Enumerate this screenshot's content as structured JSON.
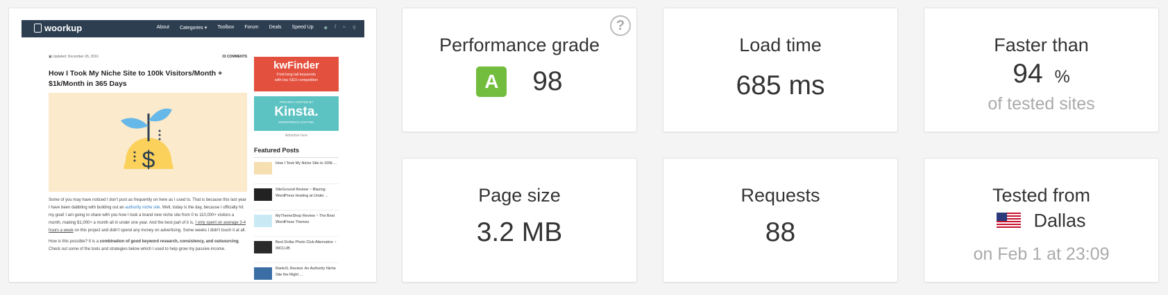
{
  "preview": {
    "site_logo": "woorkup",
    "nav_items": [
      "About",
      "Categories ▾",
      "Toolbox",
      "Forum",
      "Deals",
      "Speed Up"
    ],
    "social_icons": [
      "twitter-icon",
      "facebook-icon",
      "rss-icon",
      "search-icon"
    ],
    "date": "Updated: December 26, 2016",
    "comments": "33 COMMENTS",
    "article_title": "How I Took My Niche Site to 100k Visitors/Month + $1k/Month in 365 Days",
    "para1_a": "Some of you may have noticed I don't post as frequently on here as I used to. That is because this last year I have been dabbling with building out an ",
    "para1_link": "authority niche site",
    "para1_b": ". Well, today is the day, because I officially hit my goal! I am going to share with you how I took a brand new niche site from 0 to 110,000+ visitors a month, making $1,000+ a month all in under one year. And the best part of it is, ",
    "para1_u": "I only spent on average 3-4 hours a week",
    "para1_c": " on this project and didn't spend any money on advertising. Some weeks I didn't touch it at all.",
    "para2_a": "How is this possible? It is a ",
    "para2_bold": "combination of good keyword research, consistency, and outsourcing",
    "para2_b": ". Check out some of the tools and strategies below which I used to help grow my passive income.",
    "ad1_title": "kwFinder",
    "ad1_line1": "Find long tail keywords",
    "ad1_line2": "with low SEO competition",
    "ad2_top": "PROUDLY HOSTED BY",
    "ad2_title": "Kinsta.",
    "ad2_bottom": "WORDPRESS HOSTING",
    "advertise": "Advertise here",
    "featured_heading": "Featured Posts",
    "featured": [
      {
        "text": "How I Took My Niche Site to 100k ...",
        "color": "#f6dfb0"
      },
      {
        "text": "SiteGround Review ~ Blazing WordPress Hosting at Under ...",
        "color": "#222222"
      },
      {
        "text": "MyThemeShop Review ~ The Best WordPress Themes",
        "color": "#c9eaf5"
      },
      {
        "text": "Best Dollar Photo Club Alternative ~ 99CLUB",
        "color": "#2a2a2a"
      },
      {
        "text": "RankXL Review: An Authority Niche Site the Right ...",
        "color": "#3a6ea5"
      }
    ]
  },
  "cards": {
    "performance": {
      "label": "Performance grade",
      "grade": "A",
      "score": "98",
      "help": "?"
    },
    "load_time": {
      "label": "Load time",
      "value": "685 ms"
    },
    "faster_than": {
      "label": "Faster than",
      "value": "94",
      "unit": "%",
      "sub": "of tested sites"
    },
    "page_size": {
      "label": "Page size",
      "value": "3.2 MB"
    },
    "requests": {
      "label": "Requests",
      "value": "88"
    },
    "tested_from": {
      "label": "Tested from",
      "location": "Dallas",
      "sub": "on Feb 1 at 23:09"
    }
  },
  "colors": {
    "grade_green": "#73bd3e",
    "nav_dark": "#2d3e50"
  }
}
